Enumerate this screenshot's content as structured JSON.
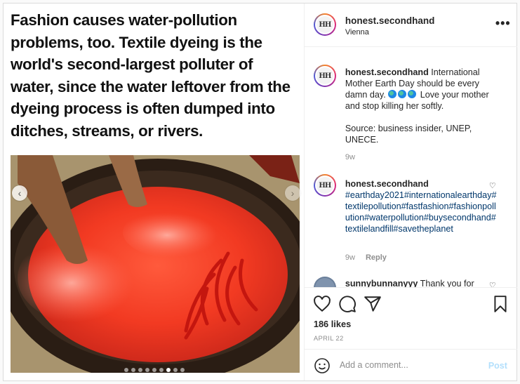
{
  "media": {
    "caption_text": "Fashion causes water-pollution problems, too. Textile dyeing is the world's second-largest polluter of water, since the water leftover from the dyeing process is often dumped into ditches, streams, or rivers.",
    "prev_arrow": "‹",
    "next_arrow": "›",
    "carousel_count": 9,
    "carousel_active": 7
  },
  "header": {
    "avatar_initials": "HH",
    "username": "honest.secondhand",
    "location": "Vienna",
    "more": "•••"
  },
  "comments": [
    {
      "username": "honest.secondhand",
      "text_before": " International Mother Earth Day should be every damn day.",
      "text_after": " Love your mother and stop killing her softly.",
      "source": "Source: business insider, UNEP, UNECE.",
      "time": "9w"
    },
    {
      "username": "honest.secondhand",
      "hashtags": "#earthday2021#internationalearthday#textilepollution#fastfashion#fashionpollution#waterpollution#buysecondhand#textilelandfill#savetheplanet",
      "time": "9w",
      "reply": "Reply"
    },
    {
      "username": "sunnybunnanyyy",
      "text": " Thank you for"
    }
  ],
  "actions": {
    "likes": "186 likes",
    "date": "APRIL 22"
  },
  "add_comment": {
    "placeholder": "Add a comment...",
    "post_label": "Post"
  },
  "colors": {
    "link": "#00376b",
    "post_disabled": "#b2dffc",
    "border": "#dbdbdb"
  }
}
